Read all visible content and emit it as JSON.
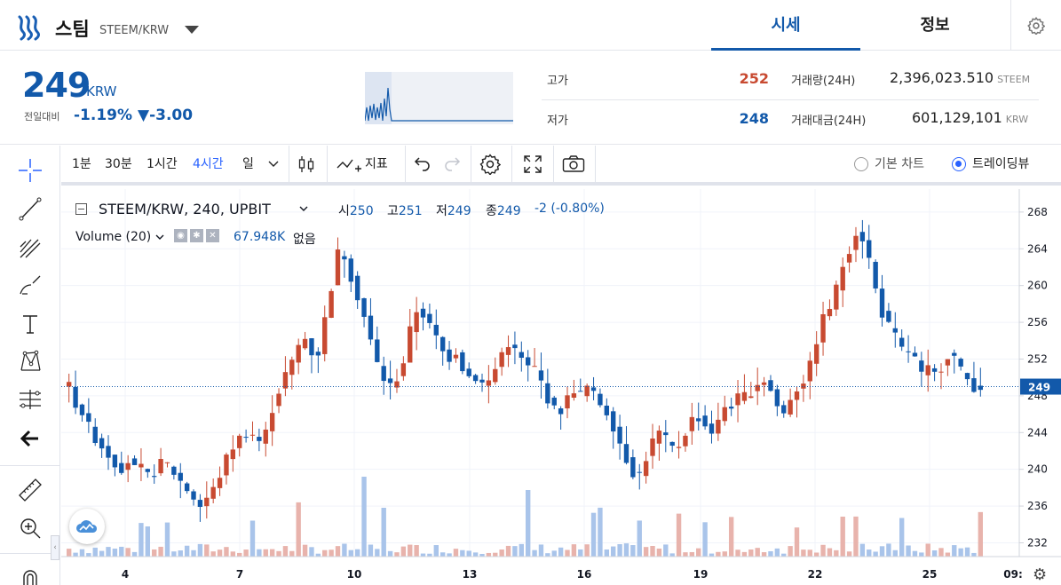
{
  "header": {
    "coin_name": "스팀",
    "pair": "STEEM/KRW",
    "tabs": [
      {
        "label": "시세",
        "active": true
      },
      {
        "label": "정보",
        "active": false
      }
    ]
  },
  "price": {
    "current": "249",
    "unit": "KRW",
    "prev_label": "전일대비",
    "change_pct": "-1.19%",
    "change_amt": "▼-3.00",
    "high_label": "고가",
    "high_value": "252",
    "low_label": "저가",
    "low_value": "248",
    "volume_label": "거래량(24H)",
    "volume_value": "2,396,023.510",
    "volume_unit": "STEEM",
    "amount_label": "거래대금(24H)",
    "amount_value": "601,129,101",
    "amount_unit": "KRW"
  },
  "colors": {
    "up": "#c84a31",
    "down": "#1259aa",
    "brand": "#1259aa",
    "accent": "#2962ff",
    "vol_up": "#e8b3ac",
    "vol_down": "#a9c4ea"
  },
  "toolbar": {
    "intervals": [
      {
        "label": "1분",
        "active": false
      },
      {
        "label": "30분",
        "active": false
      },
      {
        "label": "1시간",
        "active": false
      },
      {
        "label": "4시간",
        "active": true
      },
      {
        "label": "일",
        "active": false
      }
    ],
    "indicator_label": "지표",
    "basic_chart_label": "기본 차트",
    "tradingview_label": "트레이딩뷰"
  },
  "left_tools": [
    "crosshair-icon",
    "trendline-icon",
    "fib-icon",
    "brush-icon",
    "text-icon",
    "pattern-icon",
    "measure-icon",
    "back-arrow-icon",
    "ruler-icon",
    "zoom-in-icon",
    "magnet-icon"
  ],
  "legend": {
    "title": "STEEM/KRW, 240, UPBIT",
    "o_label": "시",
    "o": "250",
    "h_label": "고",
    "h": "251",
    "l_label": "저",
    "l": "249",
    "c_label": "종",
    "c": "249",
    "change": "-2 (-0.80%)",
    "volume_title": "Volume (20)",
    "volume_value": "67.948K",
    "volume_none": "없음"
  },
  "chart_data": {
    "type": "candlestick",
    "x_ticks": [
      "4",
      "7",
      "10",
      "13",
      "16",
      "19",
      "22",
      "25",
      "09:"
    ],
    "y_ticks": [
      232,
      236,
      240,
      244,
      248,
      252,
      256,
      260,
      264,
      268
    ],
    "ylim": [
      230.5,
      270.5
    ],
    "last_price": "249",
    "last_price_value": 249,
    "candles_count": 144,
    "grid": true
  }
}
